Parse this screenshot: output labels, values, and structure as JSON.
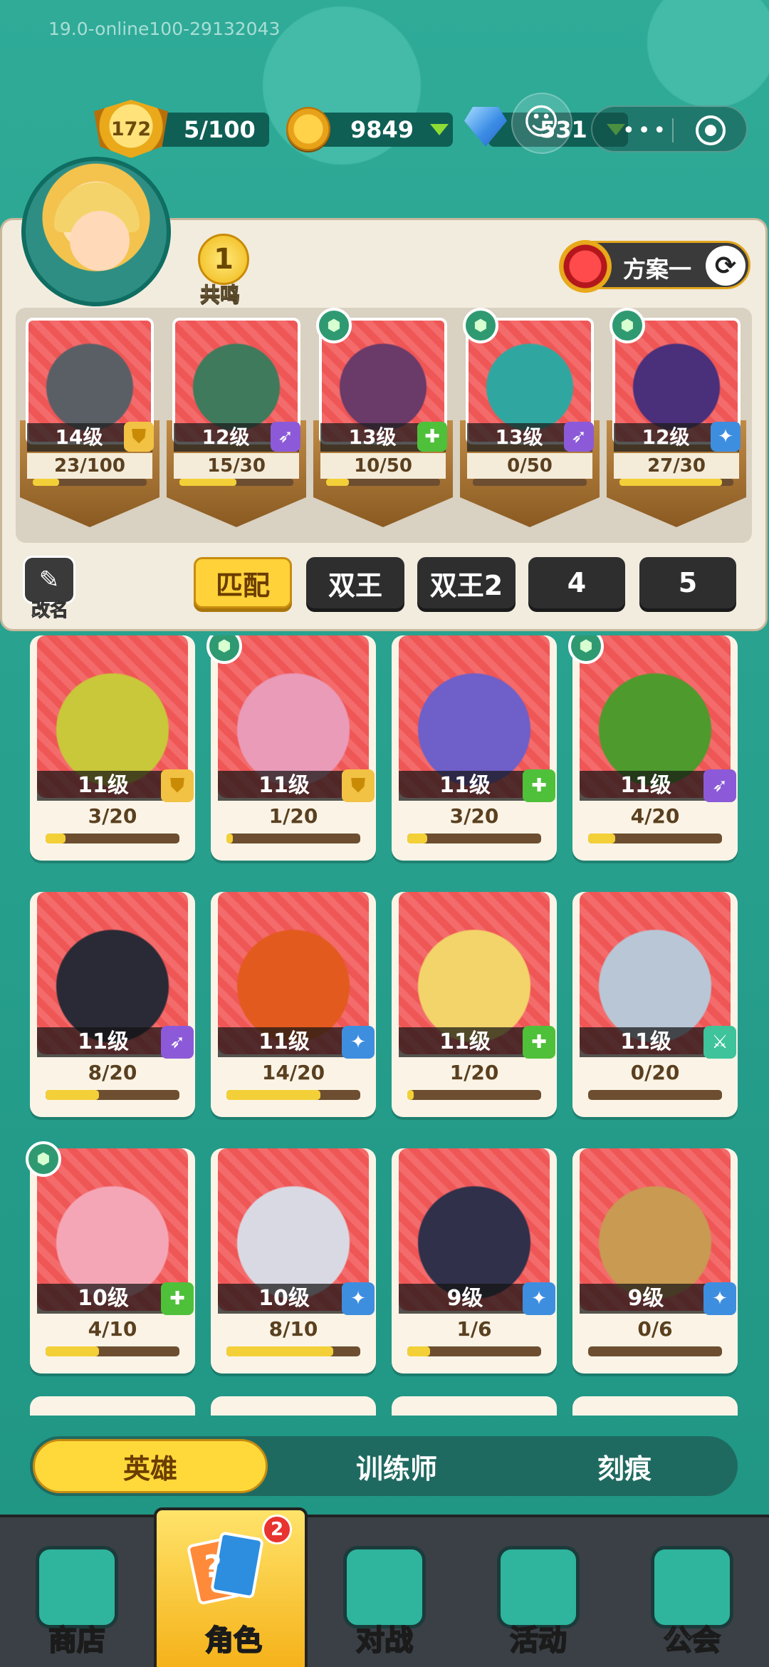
{
  "version": "19.0-online100-29132043",
  "topbar": {
    "player_level": "172",
    "stamina": "5/100",
    "gold": "9849",
    "gems": "531"
  },
  "deck": {
    "resonance_count": "1",
    "resonance_label": "共鸣",
    "plan_label": "方案一",
    "rename_label": "改名",
    "cards": [
      {
        "level": "14级",
        "progress": "23/100",
        "fill": 0.23,
        "class_icon": "shield-icon",
        "color": "#f2c244",
        "green_badge": false,
        "art": "#5a5f66"
      },
      {
        "level": "12级",
        "progress": "15/30",
        "fill": 0.5,
        "class_icon": "bow-icon",
        "color": "#8c5ad8",
        "green_badge": false,
        "art": "#3f7a5c"
      },
      {
        "level": "13级",
        "progress": "10/50",
        "fill": 0.2,
        "class_icon": "plus-icon",
        "color": "#4fc03a",
        "green_badge": true,
        "art": "#6a3a68"
      },
      {
        "level": "13级",
        "progress": "0/50",
        "fill": 0.0,
        "class_icon": "bow-icon",
        "color": "#8c5ad8",
        "green_badge": true,
        "art": "#2fa7a0"
      },
      {
        "level": "12级",
        "progress": "27/30",
        "fill": 0.9,
        "class_icon": "star-icon",
        "color": "#3e8ee0",
        "green_badge": true,
        "art": "#4a2f7a"
      }
    ],
    "tabs": [
      "匹配",
      "双王",
      "双王2",
      "4",
      "5"
    ],
    "active_tab": 0
  },
  "collection": [
    {
      "level": "11级",
      "progress": "3/20",
      "fill": 0.15,
      "class_icon": "shield-icon",
      "green_badge": false,
      "art": "#c9c73a"
    },
    {
      "level": "11级",
      "progress": "1/20",
      "fill": 0.05,
      "class_icon": "shield-icon",
      "green_badge": true,
      "art": "#e99bb8"
    },
    {
      "level": "11级",
      "progress": "3/20",
      "fill": 0.15,
      "class_icon": "plus-icon",
      "green_badge": false,
      "art": "#6f5fc8"
    },
    {
      "level": "11级",
      "progress": "4/20",
      "fill": 0.2,
      "class_icon": "bow-icon",
      "green_badge": true,
      "art": "#4e9a2c"
    },
    {
      "level": "11级",
      "progress": "8/20",
      "fill": 0.4,
      "class_icon": "bow-icon",
      "green_badge": false,
      "art": "#2a2a36"
    },
    {
      "level": "11级",
      "progress": "14/20",
      "fill": 0.7,
      "class_icon": "star-icon",
      "green_badge": false,
      "art": "#e35a1e"
    },
    {
      "level": "11级",
      "progress": "1/20",
      "fill": 0.05,
      "class_icon": "plus-icon",
      "green_badge": false,
      "art": "#f2d46a"
    },
    {
      "level": "11级",
      "progress": "0/20",
      "fill": 0.0,
      "class_icon": "sword-icon",
      "green_badge": false,
      "art": "#b9c6d6"
    },
    {
      "level": "10级",
      "progress": "4/10",
      "fill": 0.4,
      "class_icon": "plus-icon",
      "green_badge": true,
      "art": "#f4a6b6"
    },
    {
      "level": "10级",
      "progress": "8/10",
      "fill": 0.8,
      "class_icon": "star-icon",
      "green_badge": false,
      "art": "#d9d9e3"
    },
    {
      "level": "9级",
      "progress": "1/6",
      "fill": 0.17,
      "class_icon": "star-icon",
      "green_badge": false,
      "art": "#30304a"
    },
    {
      "level": "9级",
      "progress": "0/6",
      "fill": 0.0,
      "class_icon": "star-icon",
      "green_badge": false,
      "art": "#c89a52"
    }
  ],
  "subtabs": [
    "英雄",
    "训练师",
    "刻痕"
  ],
  "active_subtab": 0,
  "nav": [
    {
      "label": "商店",
      "icon": "shop-icon"
    },
    {
      "label": "角色",
      "icon": "cards-icon",
      "badge": "2"
    },
    {
      "label": "对战",
      "icon": "swords-icon"
    },
    {
      "label": "活动",
      "icon": "shield-banner-icon"
    },
    {
      "label": "公会",
      "icon": "guild-icon"
    }
  ],
  "active_nav": 1,
  "colors": {
    "background": "#2aa694",
    "accent_yellow": "#ffd23a",
    "panel": "#f2ecdf",
    "card_art_red": "#f25a5a"
  }
}
